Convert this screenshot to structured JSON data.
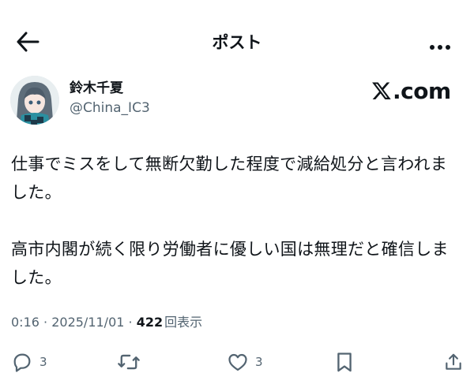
{
  "header": {
    "title": "ポスト",
    "back_icon": "arrow-left-icon",
    "more_icon": "more-horizontal-icon"
  },
  "author": {
    "display_name": "鈴木千夏",
    "handle": "@China_IC3",
    "avatar_icon": "avatar-image"
  },
  "watermark": {
    "text": ".com",
    "logo_icon": "x-logo-icon"
  },
  "tweet": {
    "paragraph_1": "仕事でミスをして無断欠勤した程度で減給処分と言われました。",
    "paragraph_2": "高市内閣が続く限り労働者に優しい国は無理だと確信しました。"
  },
  "meta": {
    "time": "0:16",
    "separator": " · ",
    "date": "2025/11/01",
    "views_count": "422",
    "views_label": "回表示"
  },
  "actions": {
    "reply_count": "3",
    "repost_count": "",
    "like_count": "3",
    "icons": [
      "reply-icon",
      "repost-icon",
      "like-icon",
      "bookmark-icon",
      "share-icon"
    ]
  },
  "colors": {
    "text": "#0f1419",
    "secondary": "#536471",
    "background": "#ffffff"
  }
}
